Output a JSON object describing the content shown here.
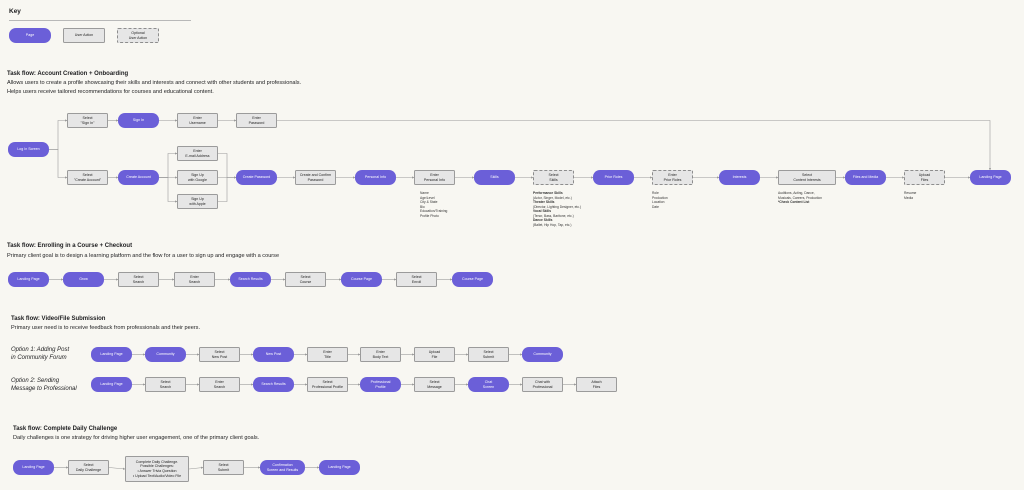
{
  "key": {
    "title": "Key",
    "page": "Page",
    "user_action": "User Action",
    "optional": "Optional\nUser Action"
  },
  "flow1": {
    "title": "Task flow: Account Creation + Onboarding",
    "desc1": "Allows users to create a profile showcasing their skills and interests and connect with other students and professionals.",
    "desc2": "Helps users receive tailored recommendations for courses and educational content.",
    "nodes": {
      "login": "Log In Screen",
      "select_signin": "Select\n\"Sign In\"",
      "signin": "Sign In",
      "enter_username": "Enter\nUsername",
      "enter_password": "Enter\nPassword",
      "select_create": "Select\n\"Create Account\"",
      "create_account": "Create Account",
      "enter_email": "Enter\nE-mail Address",
      "signup_google": "Sign Up\nwith Google",
      "signup_apple": "Sign Up\nwith Apple",
      "create_password": "Create Password",
      "create_confirm": "Create and Confirm\nPassword",
      "personal_info": "Personal Info",
      "enter_personal": "Enter\nPersonal Info",
      "skills": "Skills",
      "select_skills": "Select\nSkills",
      "prior_roles": "Prior Roles",
      "enter_prior": "Enter\nPrior Roles",
      "interests": "Interests",
      "select_interests": "Select\nContent Interests",
      "files_media": "Files and Media",
      "upload_files": "Upload\nFiles",
      "landing": "Landing Page"
    },
    "notes": {
      "personal": [
        "Name",
        "Age/Level",
        "City & State",
        "Bio",
        "Education/Training",
        "Profile Photo"
      ],
      "skills": [
        {
          "text": "Performance Skills",
          "bold": true
        },
        {
          "text": "(Actor, Singer, Model, etc.)",
          "bold": false
        },
        {
          "text": "Theater Skills",
          "bold": true
        },
        {
          "text": "(Director, Lighting Designer, etc.)",
          "bold": false
        },
        {
          "text": "Vocal Skills",
          "bold": true
        },
        {
          "text": "(Tenor, Bass, Baritone, etc.)",
          "bold": false
        },
        {
          "text": "Dance Skills",
          "bold": true
        },
        {
          "text": "(Ballet, Hip Hop, Tap, etc.)",
          "bold": false
        }
      ],
      "prior": [
        "Role",
        "Production",
        "Location",
        "Date"
      ],
      "interests": [
        {
          "text": "Auditions, Acting, Dance,",
          "bold": false
        },
        {
          "text": "Musicals, Careers, Production",
          "bold": false
        },
        {
          "text": "*Check Content List",
          "bold": true
        }
      ],
      "files": [
        "Resume",
        "Media"
      ]
    }
  },
  "flow2": {
    "title": "Task flow: Enrolling in a Course + Checkout",
    "desc": "Primary client goal is to design a learning platform and the flow for a user to sign up and engage with a course",
    "nodes": [
      "Landing Page",
      "Grow",
      "Select\nSearch",
      "Enter\nSearch",
      "Search Results",
      "Select\nCourse",
      "Course Page",
      "Select\nEnroll",
      "Course Page"
    ]
  },
  "flow3": {
    "title": "Task flow: Video/File Submission",
    "desc": "Primary user need is to receive feedback from professionals and their peers.",
    "option1_line1": "Option 1: Adding Post",
    "option1_line2": "in Community Forum",
    "option2_line1": "Option 2: Sending",
    "option2_line2": "Message to Professional",
    "opt1_nodes": [
      "Landing Page",
      "Community",
      "Select\nNew Post",
      "New Post",
      "Enter\nTitle",
      "Enter\nBody Text",
      "Upload\nFile",
      "Select\nSubmit",
      "Community"
    ],
    "opt2_nodes": [
      "Landing Page",
      "Select\nSearch",
      "Enter\nSearch",
      "Search Results",
      "Select\nProfessional Profile",
      "Professional\nProfile",
      "Select\nMessage",
      "Chat\nScreen",
      "Chat with\nProfessional",
      "Attach\nFiles"
    ]
  },
  "flow4": {
    "title": "Task flow: Complete Daily Challenge",
    "desc": "Daily challenges is one strategy for driving higher user engagement, one of the primary client goals.",
    "nodes": [
      "Landing Page",
      "Select\nDaily Challenge",
      "Complete Daily Challenge.\nPossible Challenges:\n• Answer Trivia Question\n• Upload Text/Audio/Video File",
      "Select\nSubmit",
      "Confirmation\nScreen and Results",
      "Landing Page"
    ]
  },
  "colors": {
    "page": "#6b5fd8",
    "action": "#e6e6e6",
    "edge": "#9a9a9a"
  }
}
